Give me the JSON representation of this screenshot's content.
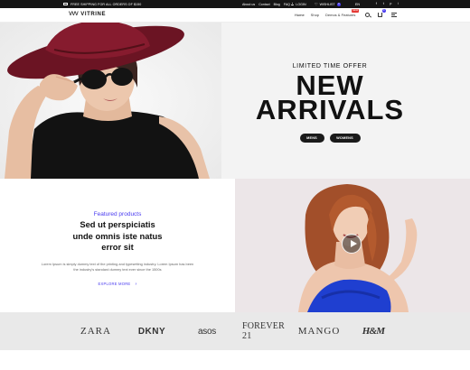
{
  "topbar": {
    "shipping": "FREE SHIPPING FOR ALL ORDERS OF $150",
    "links": [
      "About us",
      "Contact",
      "Blog",
      "FAQ"
    ],
    "login": "LOGIN",
    "wishlist": "WISHLIST",
    "wishlist_count": "0",
    "language": "EN",
    "social": [
      "f",
      "t",
      "p",
      "i"
    ]
  },
  "header": {
    "logo_mark": "VVV",
    "logo_name": "VITRINE",
    "nav": [
      "Home",
      "Shop",
      "Demos & Features"
    ],
    "new_badge": "NEW",
    "cart_count": "0"
  },
  "hero": {
    "kicker": "LIMITED TIME OFFER",
    "title_line1": "NEW",
    "title_line2": "ARRIVALS",
    "btn_men": "MENS",
    "btn_women": "WOMENS"
  },
  "featured": {
    "label": "Featured products",
    "title_line1": "Sed ut perspiciatis",
    "title_line2": "unde omnis iste natus",
    "title_line3": "error sit",
    "desc_line1": "Lorem Ipsum is simply dummy text of the printing and typesetting industry. Lorem Ipsum has been",
    "desc_line2": "the industry's standard dummy text ever since the 1500s",
    "link": "EXPLORE MORE",
    "link_arrow": "›"
  },
  "brands": [
    "ZARA",
    "DKNY",
    "asos",
    "FOREVER 21",
    "MANGO",
    "H&M"
  ],
  "colors": {
    "accent": "#4a3cf0",
    "topbar": "#151515",
    "hat": "#7a1828",
    "dress": "#1f3fd0",
    "brand_strip": "#e9e9e9"
  }
}
